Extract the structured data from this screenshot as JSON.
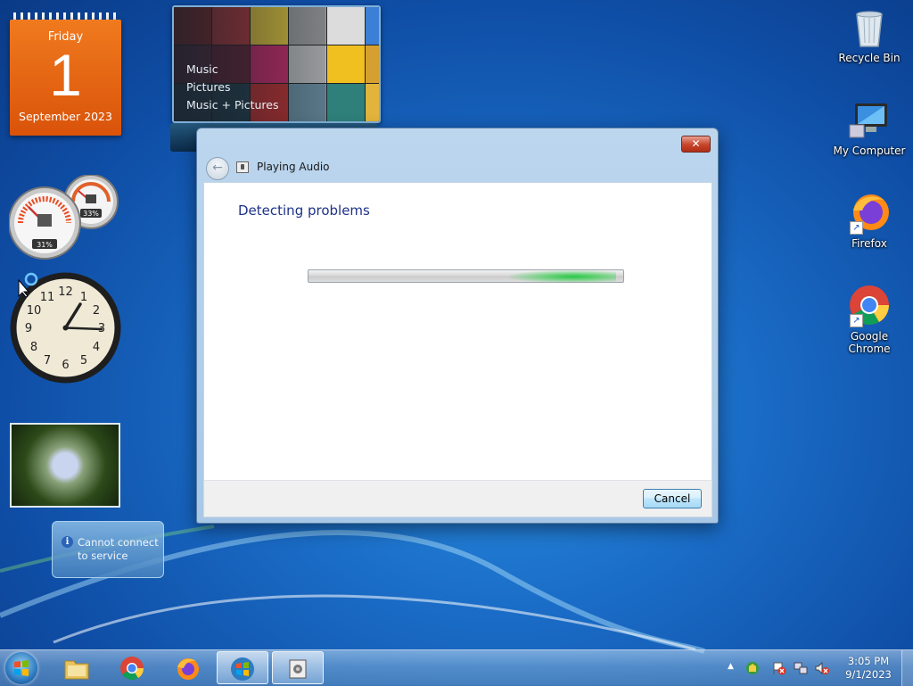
{
  "desktop": {
    "calendar": {
      "day": "Friday",
      "date": "1",
      "month_year": "September 2023"
    },
    "media_center": {
      "items": [
        "Music",
        "Pictures",
        "Music + Pictures"
      ]
    },
    "cpu_meter": {
      "cpu": "31%",
      "memory": "33%"
    },
    "clock": {
      "numerals": [
        "12",
        "1",
        "2",
        "3",
        "4",
        "5",
        "6",
        "7",
        "8",
        "9",
        "10",
        "11"
      ]
    },
    "weather": {
      "message": "Cannot connect to service"
    },
    "icons": {
      "recycle_bin": "Recycle Bin",
      "my_computer": "My Computer",
      "firefox": "Firefox",
      "chrome": "Google Chrome"
    }
  },
  "dialog": {
    "title": "Playing Audio",
    "heading": "Detecting problems",
    "cancel_label": "Cancel",
    "close_label": "✕",
    "back_label": "←",
    "progress": {
      "indeterminate": true
    }
  },
  "taskbar": {
    "apps": [
      "windows-explorer",
      "google-chrome",
      "firefox",
      "troubleshooter",
      "audio-troubleshooter"
    ],
    "clock": {
      "time": "3:05 PM",
      "date": "9/1/2023"
    },
    "tray_arrow": "▲"
  }
}
